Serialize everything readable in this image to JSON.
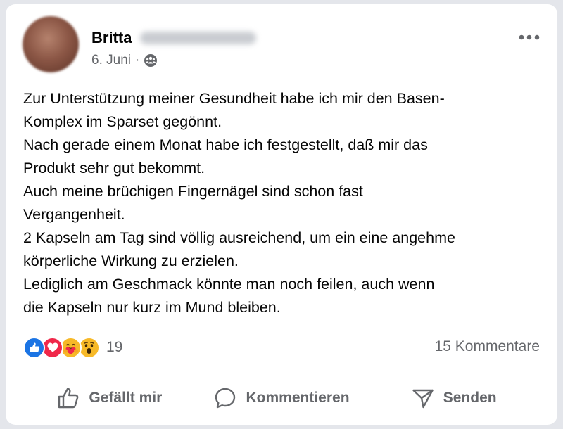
{
  "post": {
    "author_name": "Britta",
    "date": "6. Juni",
    "separator": "·",
    "audience_icon": "friends-icon",
    "more_icon": "more-options-icon",
    "body": "Zur Unterstützung meiner Gesundheit habe ich mir den Basen-\nKomplex im Sparset gegönnt.\nNach gerade einem Monat habe ich festgestellt, daß mir das\nProdukt sehr gut bekommt.\nAuch meine brüchigen Fingernägel sind schon fast\nVergangenheit.\n2 Kapseln am Tag sind völlig ausreichend, um ein eine angehme\nkörperliche Wirkung zu erzielen.\nLediglich am Geschmack könnte man noch feilen,  auch wenn\ndie Kapseln nur kurz im Mund bleiben."
  },
  "reactions": {
    "types": [
      "like",
      "love",
      "care",
      "wow"
    ],
    "count": "19",
    "comments": "15 Kommentare"
  },
  "actions": {
    "like_label": "Gefällt mir",
    "comment_label": "Kommentieren",
    "send_label": "Senden"
  },
  "colors": {
    "like_blue": "#1b74e4",
    "love_red": "#f0284a",
    "emoji_yellow": "#f7b928",
    "secondary_text": "#65676b",
    "primary_text": "#050505"
  }
}
